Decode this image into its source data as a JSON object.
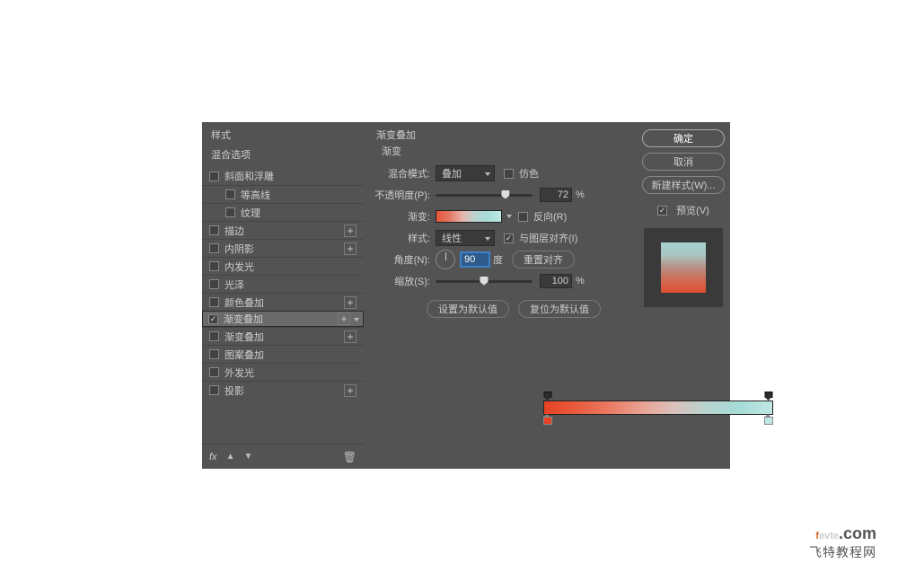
{
  "left": {
    "header": "样式",
    "sub": "混合选项",
    "items": [
      {
        "label": "斜面和浮雕",
        "checked": false,
        "plus": false,
        "indent": false
      },
      {
        "label": "等高线",
        "checked": false,
        "plus": false,
        "indent": true
      },
      {
        "label": "纹理",
        "checked": false,
        "plus": false,
        "indent": true
      },
      {
        "label": "描边",
        "checked": false,
        "plus": true,
        "indent": false
      },
      {
        "label": "内阴影",
        "checked": false,
        "plus": true,
        "indent": false
      },
      {
        "label": "内发光",
        "checked": false,
        "plus": false,
        "indent": false
      },
      {
        "label": "光泽",
        "checked": false,
        "plus": false,
        "indent": false
      },
      {
        "label": "颜色叠加",
        "checked": false,
        "plus": true,
        "indent": false
      },
      {
        "label": "渐变叠加",
        "checked": true,
        "plus": true,
        "indent": false,
        "selected": true
      },
      {
        "label": "渐变叠加",
        "checked": false,
        "plus": true,
        "indent": false
      },
      {
        "label": "图案叠加",
        "checked": false,
        "plus": false,
        "indent": false
      },
      {
        "label": "外发光",
        "checked": false,
        "plus": false,
        "indent": false
      },
      {
        "label": "投影",
        "checked": false,
        "plus": true,
        "indent": false
      }
    ],
    "fx": "fx"
  },
  "mid": {
    "title": "渐变叠加",
    "sub": "渐变",
    "blend_label": "混合模式:",
    "blend_value": "叠加",
    "dither_label": "仿色",
    "opacity_label": "不透明度(P):",
    "opacity_value": "72",
    "opacity_pct": 72,
    "gradient_label": "渐变:",
    "reverse_label": "反向(R)",
    "style_label": "样式:",
    "style_value": "线性",
    "align_label": "与图层对齐(I)",
    "angle_label": "角度(N):",
    "angle_value": "90",
    "angle_unit": "度",
    "reset_align": "重置对齐",
    "scale_label": "缩放(S):",
    "scale_value": "100",
    "scale_pct": 50,
    "btn_default": "设置为默认值",
    "btn_reset": "复位为默认值",
    "pct": "%"
  },
  "right": {
    "ok": "确定",
    "cancel": "取消",
    "newstyle": "新建样式(W)...",
    "preview": "预览(V)"
  },
  "watermark": {
    "domain": "fevte.com",
    "cn": "飞特教程网"
  },
  "chart_data": {
    "type": "table",
    "title": "Gradient Overlay parameters",
    "rows": [
      {
        "param": "blend_mode",
        "value": "叠加"
      },
      {
        "param": "dither",
        "value": false
      },
      {
        "param": "opacity_percent",
        "value": 72
      },
      {
        "param": "reverse",
        "value": false
      },
      {
        "param": "style",
        "value": "线性"
      },
      {
        "param": "align_with_layer",
        "value": true
      },
      {
        "param": "angle_deg",
        "value": 90
      },
      {
        "param": "scale_percent",
        "value": 100
      }
    ],
    "gradient": {
      "opacity_stops": [
        {
          "pos": 0,
          "opacity": 100
        },
        {
          "pos": 100,
          "opacity": 100
        }
      ],
      "color_stops": [
        {
          "pos": 0,
          "color": "#e74324"
        },
        {
          "pos": 100,
          "color": "#bfe7e3"
        }
      ]
    }
  }
}
